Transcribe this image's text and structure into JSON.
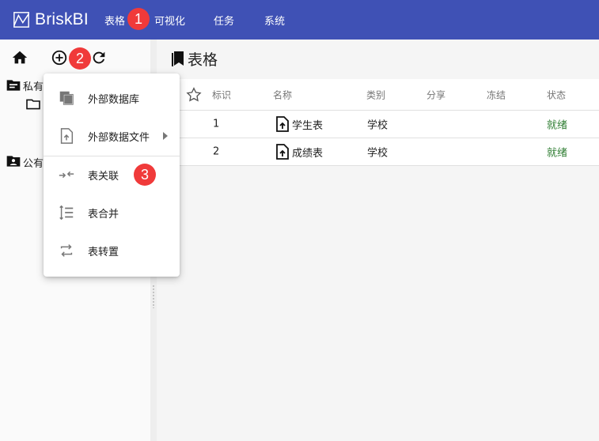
{
  "app": {
    "name": "BriskBI",
    "logo_icon": "chart-logo-icon"
  },
  "nav": {
    "items": [
      {
        "label": "表格"
      },
      {
        "label": "可视化"
      },
      {
        "label": "任务"
      },
      {
        "label": "系统"
      }
    ]
  },
  "badges": {
    "one": "1",
    "two": "2",
    "three": "3"
  },
  "sidebar": {
    "toolbar": {
      "home": "home-icon",
      "add": "add-circle-icon",
      "refresh": "refresh-icon"
    },
    "tree": {
      "private_label": "私有",
      "public_label": "公有"
    }
  },
  "menu": {
    "items": [
      {
        "label": "外部数据库",
        "icon": "copy-icon"
      },
      {
        "label": "外部数据文件",
        "icon": "file-upload-icon",
        "has_submenu": true
      },
      {
        "label": "表关联",
        "icon": "merge-arrows-icon"
      },
      {
        "label": "表合并",
        "icon": "vertical-list-icon"
      },
      {
        "label": "表转置",
        "icon": "swap-icon"
      }
    ]
  },
  "main": {
    "title": "表格",
    "columns": [
      "标识",
      "名称",
      "类别",
      "分享",
      "冻结",
      "状态"
    ],
    "rows": [
      {
        "id": "1",
        "name": "学生表",
        "category": "学校",
        "share": "",
        "frozen": "",
        "status": "就绪"
      },
      {
        "id": "2",
        "name": "成绩表",
        "category": "学校",
        "share": "",
        "frozen": "",
        "status": "就绪"
      }
    ]
  },
  "colors": {
    "appbar": "#3f51b5",
    "badge": "#f03a3a",
    "status_ok": "#2e7d32"
  }
}
